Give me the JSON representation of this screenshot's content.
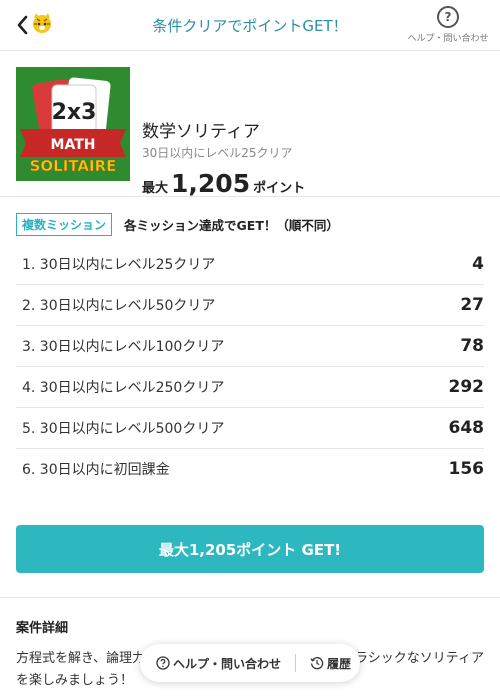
{
  "header": {
    "title": "条件クリアでポイントGET！",
    "help_label": "ヘルプ・問い合わせ"
  },
  "app": {
    "name": "数学ソリティア",
    "subtitle": "30日以内にレベル25クリア",
    "max_prefix": "最大",
    "max_points": "1,205",
    "points_unit": "ポイント",
    "icon_text_top": "2x3",
    "icon_text_banner": "MATH",
    "icon_text_bottom": "SOLITAIRE"
  },
  "missions": {
    "badge": "複数ミッション",
    "heading": "各ミッション達成でGET！（順不同）",
    "items": [
      {
        "label": "1. 30日以内にレベル25クリア",
        "points": "4"
      },
      {
        "label": "2. 30日以内にレベル50クリア",
        "points": "27"
      },
      {
        "label": "3. 30日以内にレベル100クリア",
        "points": "78"
      },
      {
        "label": "4. 30日以内にレベル250クリア",
        "points": "292"
      },
      {
        "label": "5. 30日以内にレベル500クリア",
        "points": "648"
      },
      {
        "label": "6. 30日以内に初回課金",
        "points": "156"
      }
    ]
  },
  "cta": {
    "label": "最大1,205ポイント GET!"
  },
  "details": {
    "title": "案件詳細",
    "text_line1": "方程式を解き、論理力",
    "text_line1_end": "ラシックなソリティア",
    "text_line2": "を楽しみましょう！"
  },
  "floatbar": {
    "help": "ヘルプ・問い合わせ",
    "history": "履歴"
  },
  "colors": {
    "accent": "#2db8bf",
    "title": "#2b8fa6"
  }
}
